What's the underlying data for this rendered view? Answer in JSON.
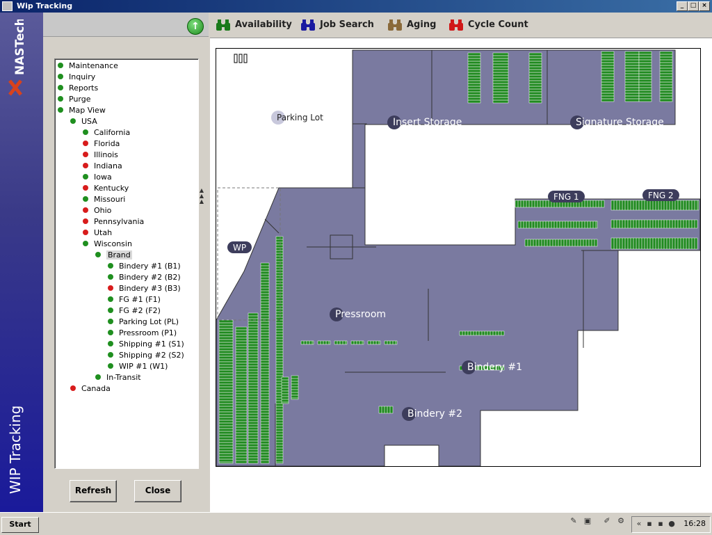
{
  "window": {
    "title": "Wip Tracking",
    "controls": [
      "_",
      "□",
      "×"
    ]
  },
  "sidebar": {
    "logo_text": "NASTech",
    "brand_label": "WIP Tracking"
  },
  "tree": [
    {
      "label": "Maintenance",
      "status": "green",
      "level": 0
    },
    {
      "label": "Inquiry",
      "status": "green",
      "level": 0
    },
    {
      "label": "Reports",
      "status": "green",
      "level": 0
    },
    {
      "label": "Purge",
      "status": "green",
      "level": 0
    },
    {
      "label": "Map View",
      "status": "green",
      "level": 0
    },
    {
      "label": "USA",
      "status": "green",
      "level": 1
    },
    {
      "label": "California",
      "status": "green",
      "level": 2
    },
    {
      "label": "Florida",
      "status": "red",
      "level": 2
    },
    {
      "label": "Illinois",
      "status": "red",
      "level": 2
    },
    {
      "label": "Indiana",
      "status": "red",
      "level": 2
    },
    {
      "label": "Iowa",
      "status": "green",
      "level": 2
    },
    {
      "label": "Kentucky",
      "status": "red",
      "level": 2
    },
    {
      "label": "Missouri",
      "status": "green",
      "level": 2
    },
    {
      "label": "Ohio",
      "status": "red",
      "level": 2
    },
    {
      "label": "Pennsylvania",
      "status": "red",
      "level": 2
    },
    {
      "label": "Utah",
      "status": "red",
      "level": 2
    },
    {
      "label": "Wisconsin",
      "status": "green",
      "level": 2
    },
    {
      "label": "Brand",
      "status": "green",
      "level": 3,
      "selected": true
    },
    {
      "label": "Bindery #1 (B1)",
      "status": "green",
      "level": 4
    },
    {
      "label": "Bindery #2 (B2)",
      "status": "green",
      "level": 4
    },
    {
      "label": "Bindery #3 (B3)",
      "status": "red",
      "level": 4
    },
    {
      "label": "FG #1 (F1)",
      "status": "green",
      "level": 4
    },
    {
      "label": "FG #2 (F2)",
      "status": "green",
      "level": 4
    },
    {
      "label": "Parking Lot (PL)",
      "status": "green",
      "level": 4
    },
    {
      "label": "Pressroom (P1)",
      "status": "green",
      "level": 4
    },
    {
      "label": "Shipping #1 (S1)",
      "status": "green",
      "level": 4
    },
    {
      "label": "Shipping #2 (S2)",
      "status": "green",
      "level": 4
    },
    {
      "label": "WIP #1 (W1)",
      "status": "green",
      "level": 4
    },
    {
      "label": "In-Transit",
      "status": "green",
      "level": 3
    },
    {
      "label": "Canada",
      "status": "red",
      "level": 1
    }
  ],
  "buttons": {
    "refresh": "Refresh",
    "close": "Close"
  },
  "toolbar": [
    {
      "label": "Availability",
      "color": "#1a7a1a"
    },
    {
      "label": "Job Search",
      "color": "#1a1aa0"
    },
    {
      "label": "Aging",
      "color": "#8a6a3a"
    },
    {
      "label": "Cycle Count",
      "color": "#d01818"
    }
  ],
  "map": {
    "areas": {
      "parking_lot": "Parking Lot",
      "insert_storage": "Insert Storage",
      "signature_storage": "Signature Storage",
      "fng1": "FNG 1",
      "fng2": "FNG 2",
      "wp": "WP",
      "pressroom": "Pressroom",
      "bindery1": "Bindery #1",
      "bindery2": "Bindery #2"
    },
    "building_color": "#7a7aa0",
    "rack_color": "#1f8a1f"
  },
  "taskbar": {
    "start": "Start",
    "clock": "16:28"
  }
}
